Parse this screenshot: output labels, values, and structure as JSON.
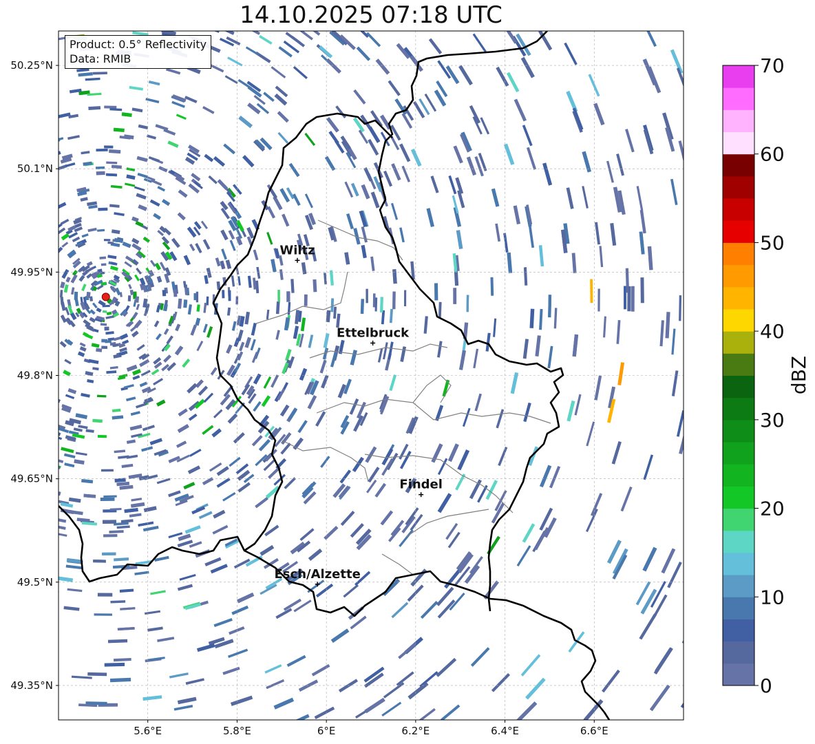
{
  "title": "14.10.2025 07:18 UTC",
  "info": {
    "product": "Product: 0.5° Reflectivity",
    "source": "Data: RMIB"
  },
  "map": {
    "lon_range": [
      5.4,
      6.8
    ],
    "lat_range": [
      49.3,
      50.3
    ],
    "x_ticks": [
      {
        "value": 5.6,
        "label": "5.6°E"
      },
      {
        "value": 5.8,
        "label": "5.8°E"
      },
      {
        "value": 6.0,
        "label": "6°E"
      },
      {
        "value": 6.2,
        "label": "6.2°E"
      },
      {
        "value": 6.4,
        "label": "6.4°E"
      },
      {
        "value": 6.6,
        "label": "6.6°E"
      }
    ],
    "y_ticks": [
      {
        "value": 50.25,
        "label": "50.25°N"
      },
      {
        "value": 50.1,
        "label": "50.1°N"
      },
      {
        "value": 49.95,
        "label": "49.95°N"
      },
      {
        "value": 49.8,
        "label": "49.8°N"
      },
      {
        "value": 49.65,
        "label": "49.65°N"
      },
      {
        "value": 49.5,
        "label": "49.5°N"
      },
      {
        "value": 49.35,
        "label": "49.35°N"
      }
    ],
    "gridlines": true,
    "radar_site": {
      "lon": 5.506,
      "lat": 49.914
    },
    "cities": [
      {
        "name": "Wiltz",
        "lon": 5.935,
        "lat": 49.967
      },
      {
        "name": "Ettelbruck",
        "lon": 6.104,
        "lat": 49.847
      },
      {
        "name": "Findel",
        "lon": 6.212,
        "lat": 49.627
      },
      {
        "name": "Esch/Alzette",
        "lon": 5.98,
        "lat": 49.497
      }
    ]
  },
  "colorbar": {
    "label": "dBZ",
    "min": 0,
    "max": 70,
    "step": 2.5,
    "tick_labels": [
      "0",
      "10",
      "20",
      "30",
      "40",
      "50",
      "60",
      "70"
    ],
    "colors": [
      "#6673a6",
      "#56699f",
      "#4060a3",
      "#4878ad",
      "#5b9bc6",
      "#63bfda",
      "#5ed6c6",
      "#40d570",
      "#13c826",
      "#12b520",
      "#10a21c",
      "#0e8e18",
      "#0c7b14",
      "#0a6410",
      "#4a7a12",
      "#aab10c",
      "#ffd700",
      "#ffb400",
      "#ff9a00",
      "#ff7f00",
      "#e60000",
      "#c80000",
      "#a00000",
      "#780000",
      "#ffe0ff",
      "#ffb3ff",
      "#ff6cff",
      "#e83ef0"
    ]
  },
  "chart_data": {
    "type": "map",
    "title": "14.10.2025 07:18 UTC",
    "x_ticks": [
      "5.6°E",
      "5.8°E",
      "6°E",
      "6.2°E",
      "6.4°E",
      "6.6°E"
    ],
    "y_ticks": [
      "50.25°N",
      "50.1°N",
      "49.95°N",
      "49.8°N",
      "49.65°N",
      "49.5°N",
      "49.35°N"
    ],
    "xlim": [
      5.4,
      6.8
    ],
    "ylim": [
      49.3,
      50.3
    ],
    "colorbar_label": "dBZ",
    "colorbar_range": [
      0,
      70
    ],
    "annotations": [
      "Wiltz",
      "Ettelbruck",
      "Findel",
      "Esch/Alzette"
    ],
    "grid": true
  }
}
